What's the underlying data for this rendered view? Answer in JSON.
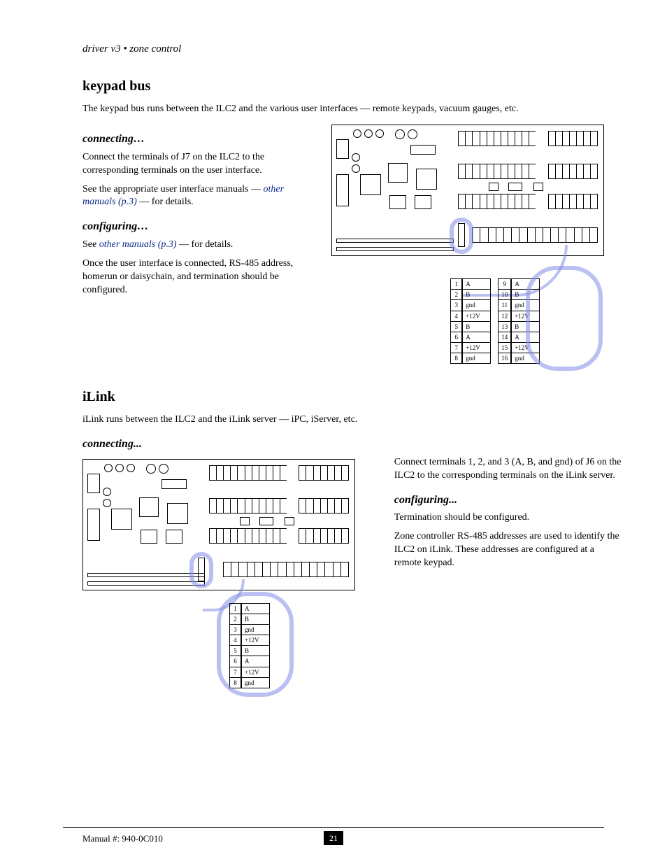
{
  "doc": {
    "running_head": "driver v3 • zone control",
    "footer": "Manual #: 940-0C010",
    "page_number": "21"
  },
  "sec1": {
    "title": "keypad bus",
    "intro": "The keypad bus runs between the ILC2 and the various user interfaces — remote keypads, vacuum gauges, etc.",
    "h_conn": "connecting…",
    "conn_p1": "Connect the terminals of J7 on the ILC2 to the corresponding terminals on the user interface.",
    "conn_p2_a": "See the appropriate user interface manuals — ",
    "conn_p2_link": "other manuals (p.3)",
    "conn_p2_b": " — for details.",
    "h_cfg": "configuring…",
    "cfg_p1_a": "See ",
    "cfg_p1_link": "other manuals (p.3)",
    "cfg_p1_b": " — for details.",
    "cfg_p2": "Once the user interface is connected, RS-485 address, homerun or daisychain, and termination should be configured.",
    "table_a": [
      {
        "n": "1",
        "l": "A"
      },
      {
        "n": "2",
        "l": "B"
      },
      {
        "n": "3",
        "l": "gnd"
      },
      {
        "n": "4",
        "l": "+12V"
      },
      {
        "n": "5",
        "l": "B"
      },
      {
        "n": "6",
        "l": "A"
      },
      {
        "n": "7",
        "l": "+12V"
      },
      {
        "n": "8",
        "l": "gnd"
      }
    ],
    "table_b": [
      {
        "n": "9",
        "l": "A"
      },
      {
        "n": "10",
        "l": "B"
      },
      {
        "n": "11",
        "l": "gnd"
      },
      {
        "n": "12",
        "l": "+12V"
      },
      {
        "n": "13",
        "l": "B"
      },
      {
        "n": "14",
        "l": "A"
      },
      {
        "n": "15",
        "l": "+12V"
      },
      {
        "n": "16",
        "l": "gnd"
      }
    ]
  },
  "sec2": {
    "title": "iLink",
    "intro": "iLink runs between the ILC2 and the iLink server — iPC, iServer, etc.",
    "h_conn": "connecting...",
    "conn_p1": "Connect terminals 1, 2, and 3 (A, B, and gnd) of J6 on the ILC2 to the corresponding terminals on the iLink server.",
    "h_cfg": "configuring...",
    "cfg_p1": "Termination should be configured.",
    "cfg_p2": "Zone controller RS-485 addresses are used to identify the ILC2 on iLink. These addresses are configured at a remote keypad.",
    "table": [
      {
        "n": "1",
        "l": "A"
      },
      {
        "n": "2",
        "l": "B"
      },
      {
        "n": "3",
        "l": "gnd"
      },
      {
        "n": "4",
        "l": "+12V"
      },
      {
        "n": "5",
        "l": "B"
      },
      {
        "n": "6",
        "l": "A"
      },
      {
        "n": "7",
        "l": "+12V"
      },
      {
        "n": "8",
        "l": "gnd"
      }
    ]
  }
}
